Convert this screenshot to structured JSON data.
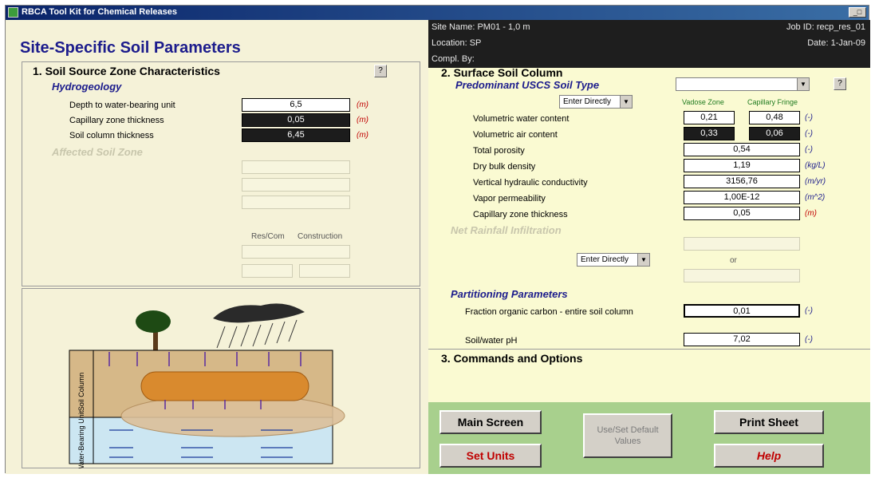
{
  "window": {
    "title": "RBCA Tool Kit for Chemical Releases",
    "controls": "_□"
  },
  "left": {
    "page_title": "Site-Specific Soil Parameters",
    "section1": "1. Soil Source Zone Characteristics",
    "help": "?",
    "hydro_title": "Hydrogeology",
    "rows": [
      {
        "label": "Depth to water-bearing unit",
        "value": "6,5",
        "unit": "(m)"
      },
      {
        "label": "Capillary zone thickness",
        "value": "0,05",
        "unit": "(m)"
      },
      {
        "label": "Soil column thickness",
        "value": "6,45",
        "unit": "(m)"
      }
    ],
    "faint_title": "Affected Soil Zone",
    "res_com": "Res/Com",
    "construction": "Construction",
    "diagram": {
      "soil_column": "Soil Column",
      "water_bearing": "Water-Bearing Unit"
    }
  },
  "info": {
    "site_name": "Site Name:  PM01 - 1,0 m",
    "job_id": "Job ID:  recp_res_01",
    "location": "Location:  SP",
    "date": "Date:  1-Jan-09",
    "compl_by": "Compl. By:"
  },
  "right": {
    "section2": "2. Surface Soil Column",
    "uscs_title": "Predominant USCS Soil Type",
    "uscs_value": "",
    "help": "?",
    "enter_directly": "Enter Directly",
    "vadose_header": "Vadose Zone",
    "capfringe_header": "Capillary Fringe",
    "params": [
      {
        "label": "Volumetric water content",
        "vadose": "0,21",
        "cap": "0,48",
        "unit": "(-)"
      },
      {
        "label": "Volumetric air content",
        "vadose": "0,33",
        "cap": "0,06",
        "unit": "(-)"
      },
      {
        "label": "Total porosity",
        "value": "0,54",
        "unit": "(-)"
      },
      {
        "label": "Dry bulk density",
        "value": "1,19",
        "unit": "(kg/L)"
      },
      {
        "label": "Vertical hydraulic conductivity",
        "value": "3156,76",
        "unit": "(m/yr)"
      },
      {
        "label": "Vapor permeability",
        "value": "1,00E-12",
        "unit": "(m^2)"
      },
      {
        "label": "Capillary zone thickness",
        "value": "0,05",
        "unit": "(m)"
      }
    ],
    "net_rain_title": "Net Rainfall Infiltration",
    "enter_directly2": "Enter Directly",
    "or": "or",
    "partition_title": "Partitioning Parameters",
    "foc_label": "Fraction organic carbon - entire soil column",
    "foc_value": "0,01",
    "foc_unit": "(-)",
    "ph_label": "Soil/water pH",
    "ph_value": "7,02",
    "ph_unit": "(-)"
  },
  "commands": {
    "title": "3. Commands and Options",
    "main_screen": "Main Screen",
    "set_units": "Set Units",
    "default_values": "Use/Set Default Values",
    "print_sheet": "Print Sheet",
    "help": "Help"
  }
}
